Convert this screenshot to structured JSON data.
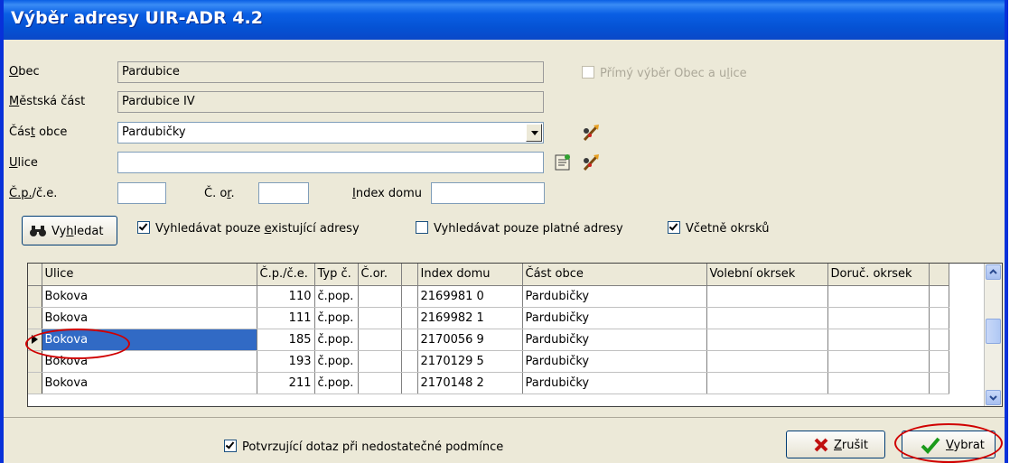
{
  "window": {
    "title": "Výběr adresy UIR-ADR 4.2"
  },
  "form": {
    "obec": {
      "label_key": "O",
      "label_rest": "bec",
      "value": "Pardubice"
    },
    "mestska_cast": {
      "label_key": "M",
      "label_rest": "ěstská část",
      "value": "Pardubice IV"
    },
    "cast_obce": {
      "label_pre": "Čás",
      "label_key": "t",
      "label_rest": " obce",
      "value": "Pardubičky"
    },
    "ulice": {
      "label_key": "U",
      "label_rest": "lice",
      "value": ""
    },
    "cp_ce": {
      "label_key": "Č.p.",
      "label_rest": "/č.e.",
      "value": ""
    },
    "c_or": {
      "label_pre": "Č. o",
      "label_key": "r",
      "label_rest": ".",
      "value": ""
    },
    "index_domu": {
      "label_key": "I",
      "label_rest": "ndex domu",
      "value": ""
    },
    "primy_vyber": {
      "pre": "Přímý výběr Obec a u",
      "key": "l",
      "rest": "ice",
      "checked": false,
      "disabled": true
    }
  },
  "search": {
    "button_pre": "Vy",
    "button_key": "h",
    "button_rest": "ledat",
    "opt_existujici": {
      "pre": "Vyhledávat pouze ",
      "key": "e",
      "rest": "xistující adresy",
      "checked": true
    },
    "opt_platne": {
      "label": "Vyhledávat pouze platné adresy",
      "checked": false
    },
    "opt_okrsky": {
      "label": "Včetně okrsků",
      "checked": true
    }
  },
  "grid": {
    "columns": [
      "Ulice",
      "Č.p./č.e.",
      "Typ č.",
      "Č.or.",
      "",
      "Index domu",
      "Část obce",
      "Volební okrsek",
      "Doruč. okrsek",
      ""
    ],
    "rows": [
      {
        "ulice": "Bokova",
        "cp": "110",
        "typ": "č.pop.",
        "cor": "",
        "x": "",
        "index": "2169981 0",
        "cast": "Pardubičky",
        "vol": "",
        "dor": "",
        "selected": false
      },
      {
        "ulice": "Bokova",
        "cp": "111",
        "typ": "č.pop.",
        "cor": "",
        "x": "",
        "index": "2169982 1",
        "cast": "Pardubičky",
        "vol": "",
        "dor": "",
        "selected": false
      },
      {
        "ulice": "Bokova",
        "cp": "185",
        "typ": "č.pop.",
        "cor": "",
        "x": "",
        "index": "2170056 9",
        "cast": "Pardubičky",
        "vol": "",
        "dor": "",
        "selected": true
      },
      {
        "ulice": "Bokova",
        "cp": "193",
        "typ": "č.pop.",
        "cor": "",
        "x": "",
        "index": "2170129 5",
        "cast": "Pardubičky",
        "vol": "",
        "dor": "",
        "selected": false
      },
      {
        "ulice": "Bokova",
        "cp": "211",
        "typ": "č.pop.",
        "cor": "",
        "x": "",
        "index": "2170148 2",
        "cast": "Pardubičky",
        "vol": "",
        "dor": "",
        "selected": false
      }
    ]
  },
  "footer": {
    "confirm": {
      "label": "Potvrzující dotaz při nedostatečné podmínce",
      "checked": true
    },
    "cancel_key": "Z",
    "cancel_rest": "rušit",
    "ok_key": "V",
    "ok_rest": "ybrat"
  },
  "colors": {
    "accent": "#0a5fe4",
    "selection": "#316ac5",
    "highlight_ring": "#d00000"
  }
}
